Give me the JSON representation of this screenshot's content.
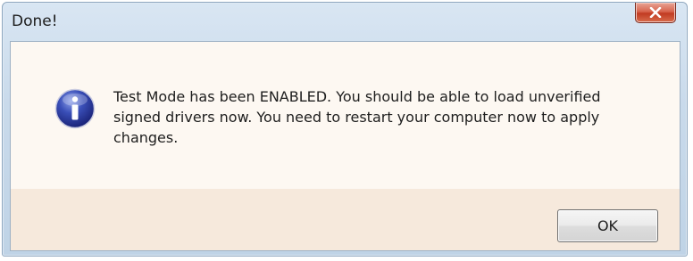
{
  "dialog": {
    "title": "Done!",
    "message": "Test Mode has been ENABLED. You should be able to load unverified signed drivers now. You need to restart your computer now to apply changes.",
    "icon": "info-icon",
    "close_icon": "close-icon",
    "ok_label": "OK"
  },
  "colors": {
    "title_bar": "#c9daeb",
    "content_bg": "#fdf8f2",
    "footer_bg": "#f6e9dc",
    "close_button": "#c13b22",
    "info_icon": "#2b3fa0"
  }
}
